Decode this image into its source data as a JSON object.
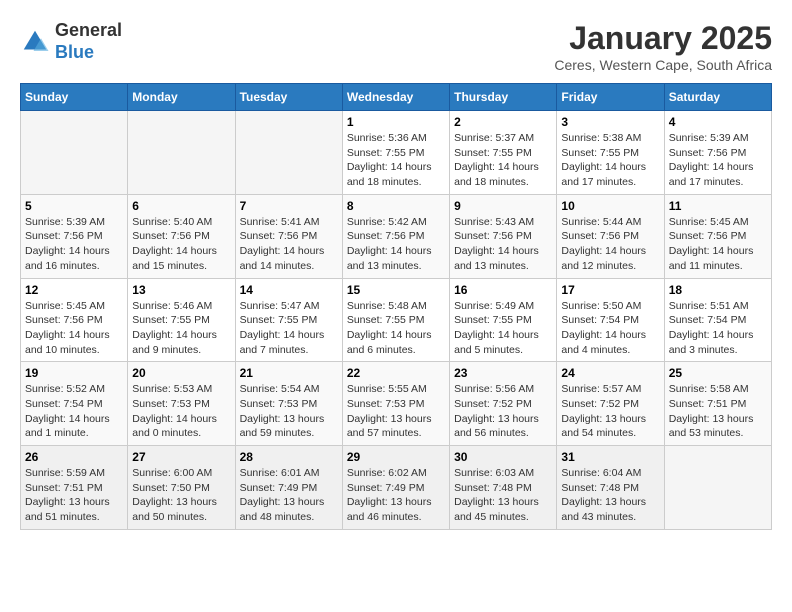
{
  "header": {
    "logo": {
      "line1": "General",
      "line2": "Blue"
    },
    "title": "January 2025",
    "subtitle": "Ceres, Western Cape, South Africa"
  },
  "weekdays": [
    "Sunday",
    "Monday",
    "Tuesday",
    "Wednesday",
    "Thursday",
    "Friday",
    "Saturday"
  ],
  "weeks": [
    [
      {
        "day": "",
        "info": ""
      },
      {
        "day": "",
        "info": ""
      },
      {
        "day": "",
        "info": ""
      },
      {
        "day": "1",
        "info": "Sunrise: 5:36 AM\nSunset: 7:55 PM\nDaylight: 14 hours\nand 18 minutes."
      },
      {
        "day": "2",
        "info": "Sunrise: 5:37 AM\nSunset: 7:55 PM\nDaylight: 14 hours\nand 18 minutes."
      },
      {
        "day": "3",
        "info": "Sunrise: 5:38 AM\nSunset: 7:55 PM\nDaylight: 14 hours\nand 17 minutes."
      },
      {
        "day": "4",
        "info": "Sunrise: 5:39 AM\nSunset: 7:56 PM\nDaylight: 14 hours\nand 17 minutes."
      }
    ],
    [
      {
        "day": "5",
        "info": "Sunrise: 5:39 AM\nSunset: 7:56 PM\nDaylight: 14 hours\nand 16 minutes."
      },
      {
        "day": "6",
        "info": "Sunrise: 5:40 AM\nSunset: 7:56 PM\nDaylight: 14 hours\nand 15 minutes."
      },
      {
        "day": "7",
        "info": "Sunrise: 5:41 AM\nSunset: 7:56 PM\nDaylight: 14 hours\nand 14 minutes."
      },
      {
        "day": "8",
        "info": "Sunrise: 5:42 AM\nSunset: 7:56 PM\nDaylight: 14 hours\nand 13 minutes."
      },
      {
        "day": "9",
        "info": "Sunrise: 5:43 AM\nSunset: 7:56 PM\nDaylight: 14 hours\nand 13 minutes."
      },
      {
        "day": "10",
        "info": "Sunrise: 5:44 AM\nSunset: 7:56 PM\nDaylight: 14 hours\nand 12 minutes."
      },
      {
        "day": "11",
        "info": "Sunrise: 5:45 AM\nSunset: 7:56 PM\nDaylight: 14 hours\nand 11 minutes."
      }
    ],
    [
      {
        "day": "12",
        "info": "Sunrise: 5:45 AM\nSunset: 7:56 PM\nDaylight: 14 hours\nand 10 minutes."
      },
      {
        "day": "13",
        "info": "Sunrise: 5:46 AM\nSunset: 7:55 PM\nDaylight: 14 hours\nand 9 minutes."
      },
      {
        "day": "14",
        "info": "Sunrise: 5:47 AM\nSunset: 7:55 PM\nDaylight: 14 hours\nand 7 minutes."
      },
      {
        "day": "15",
        "info": "Sunrise: 5:48 AM\nSunset: 7:55 PM\nDaylight: 14 hours\nand 6 minutes."
      },
      {
        "day": "16",
        "info": "Sunrise: 5:49 AM\nSunset: 7:55 PM\nDaylight: 14 hours\nand 5 minutes."
      },
      {
        "day": "17",
        "info": "Sunrise: 5:50 AM\nSunset: 7:54 PM\nDaylight: 14 hours\nand 4 minutes."
      },
      {
        "day": "18",
        "info": "Sunrise: 5:51 AM\nSunset: 7:54 PM\nDaylight: 14 hours\nand 3 minutes."
      }
    ],
    [
      {
        "day": "19",
        "info": "Sunrise: 5:52 AM\nSunset: 7:54 PM\nDaylight: 14 hours\nand 1 minute."
      },
      {
        "day": "20",
        "info": "Sunrise: 5:53 AM\nSunset: 7:53 PM\nDaylight: 14 hours\nand 0 minutes."
      },
      {
        "day": "21",
        "info": "Sunrise: 5:54 AM\nSunset: 7:53 PM\nDaylight: 13 hours\nand 59 minutes."
      },
      {
        "day": "22",
        "info": "Sunrise: 5:55 AM\nSunset: 7:53 PM\nDaylight: 13 hours\nand 57 minutes."
      },
      {
        "day": "23",
        "info": "Sunrise: 5:56 AM\nSunset: 7:52 PM\nDaylight: 13 hours\nand 56 minutes."
      },
      {
        "day": "24",
        "info": "Sunrise: 5:57 AM\nSunset: 7:52 PM\nDaylight: 13 hours\nand 54 minutes."
      },
      {
        "day": "25",
        "info": "Sunrise: 5:58 AM\nSunset: 7:51 PM\nDaylight: 13 hours\nand 53 minutes."
      }
    ],
    [
      {
        "day": "26",
        "info": "Sunrise: 5:59 AM\nSunset: 7:51 PM\nDaylight: 13 hours\nand 51 minutes."
      },
      {
        "day": "27",
        "info": "Sunrise: 6:00 AM\nSunset: 7:50 PM\nDaylight: 13 hours\nand 50 minutes."
      },
      {
        "day": "28",
        "info": "Sunrise: 6:01 AM\nSunset: 7:49 PM\nDaylight: 13 hours\nand 48 minutes."
      },
      {
        "day": "29",
        "info": "Sunrise: 6:02 AM\nSunset: 7:49 PM\nDaylight: 13 hours\nand 46 minutes."
      },
      {
        "day": "30",
        "info": "Sunrise: 6:03 AM\nSunset: 7:48 PM\nDaylight: 13 hours\nand 45 minutes."
      },
      {
        "day": "31",
        "info": "Sunrise: 6:04 AM\nSunset: 7:48 PM\nDaylight: 13 hours\nand 43 minutes."
      },
      {
        "day": "",
        "info": ""
      }
    ]
  ]
}
